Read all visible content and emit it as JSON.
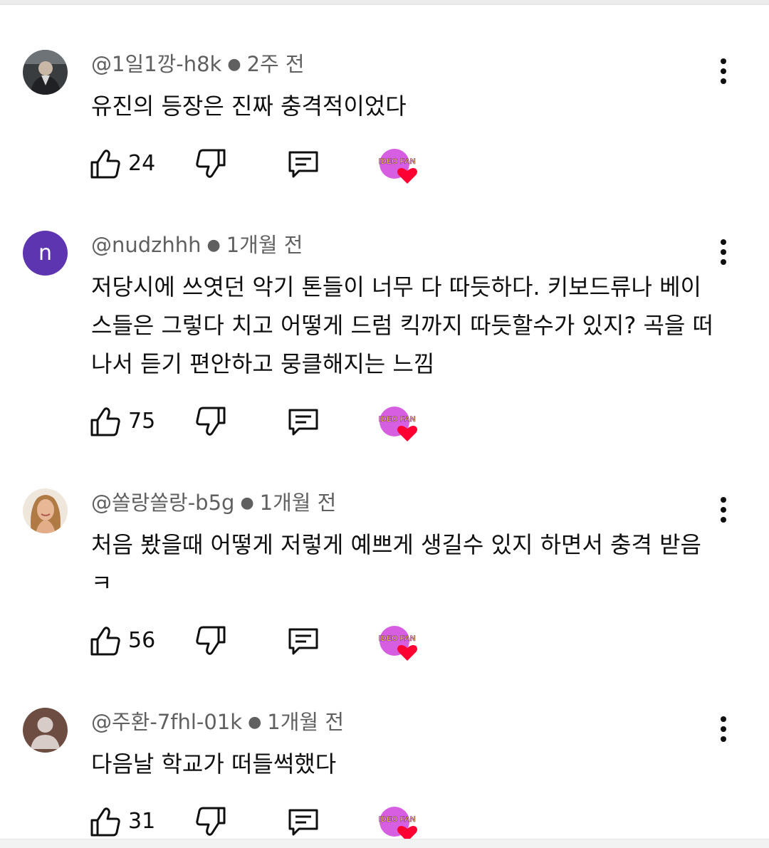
{
  "comments": [
    {
      "author": "@1일1깡-h8k",
      "time": "2주 전",
      "text": "유진의 등장은 진짜 충격적이었다",
      "likes": "24",
      "avatar": "photo"
    },
    {
      "author": "@nudzhhh",
      "time": "1개월 전",
      "text": "저당시에 쓰엿던 악기 톤들이 너무 다 따듯하다. 키보드류나 베이스들은 그렇다 치고 어떻게 드럼 킥까지 따듯할수가 있지? 곡을 떠나서 듣기 편안하고 뭉클해지는 느낌",
      "likes": "75",
      "avatar": "letter",
      "avatar_letter": "n"
    },
    {
      "author": "@쏠랑쏠랑-b5g",
      "time": "1개월 전",
      "text": "처음 봤을때 어떻게 저렇게 예쁘게 생길수 있지 하면서 충격 받음ㅋ",
      "likes": "56",
      "avatar": "photo"
    },
    {
      "author": "@주환-7fhl-01k",
      "time": "1개월 전",
      "text": "다음날 학교가 떠들썩했다",
      "likes": "31",
      "avatar": "default"
    }
  ],
  "badge_text": "VIDEO FAN",
  "icons": {
    "like": "thumb-up-icon",
    "dislike": "thumb-down-icon",
    "reply": "reply-icon",
    "more": "more-vert-icon",
    "badge": "video-fan-heart-badge"
  },
  "colors": {
    "text": "#0f0f0f",
    "meta": "#606060",
    "avatar_letter_bg": "#5e35b1",
    "badge_pink": "#d65ee0",
    "badge_heart": "#ff0033"
  }
}
